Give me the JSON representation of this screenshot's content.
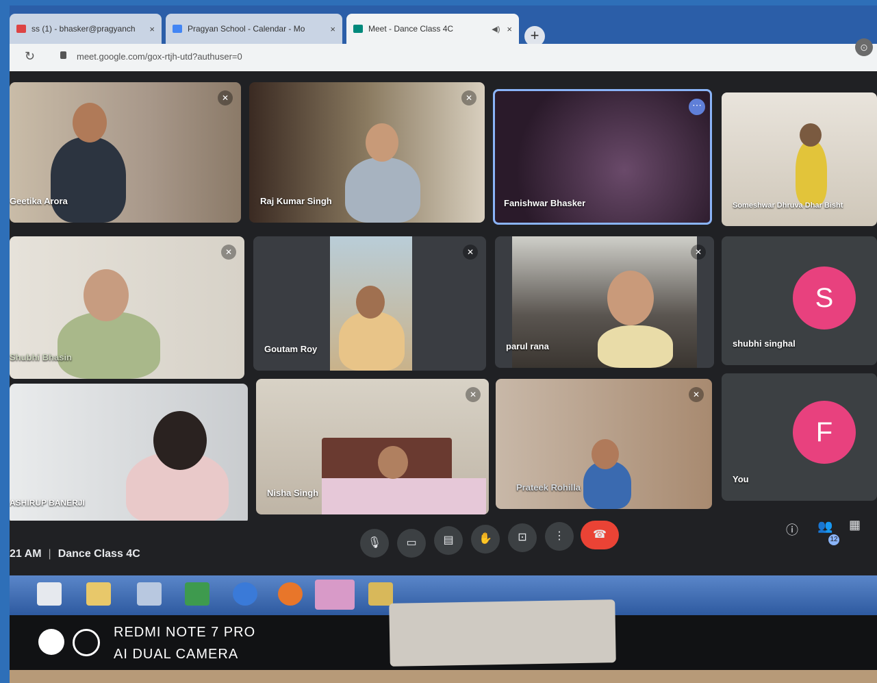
{
  "browser": {
    "tabs": [
      {
        "label": "ss (1) - bhasker@pragyanch",
        "close": "×"
      },
      {
        "label": "Pragyan School - Calendar - Mo",
        "close": "×"
      },
      {
        "label": "Meet - Dance Class 4C",
        "close": "×",
        "active": true
      }
    ],
    "new_tab": "+",
    "url": "meet.google.com/gox-rtjh-utd?authuser=0"
  },
  "participants": [
    {
      "name": "Geetika Arora"
    },
    {
      "name": "Raj Kumar Singh"
    },
    {
      "name": "Fanishwar Bhasker"
    },
    {
      "name": "Someshwar Dhruva Dhar Bisht"
    },
    {
      "name": "Shubhi Bhasin"
    },
    {
      "name": "Goutam Roy"
    },
    {
      "name": "parul rana"
    },
    {
      "name": "shubhi singhal",
      "initial": "S"
    },
    {
      "name": "ASHIRUP BANERJI"
    },
    {
      "name": "Nisha Singh"
    },
    {
      "name": "Prateek Rohilla"
    },
    {
      "name": "You",
      "initial": "F"
    }
  ],
  "meeting": {
    "time": "21 AM",
    "separator": "|",
    "title": "Dance Class 4C",
    "participant_count": "12"
  },
  "watermark": {
    "line1": "REDMI NOTE 7 PRO",
    "line2": "AI DUAL CAMERA"
  },
  "colors": {
    "meet_bg": "#202124",
    "end_call": "#ea4335",
    "avatar": "#e8417e",
    "highlight": "#8ab4f8"
  }
}
